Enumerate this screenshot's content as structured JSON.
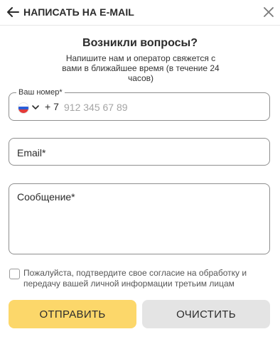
{
  "header": {
    "back_icon": "arrow-left-icon",
    "title": "НАПИСАТЬ НА E-MAIL",
    "close_icon": "close-icon"
  },
  "form": {
    "title": "Возникли вопросы?",
    "subtitle": "Напишите нам и оператор свяжется с вами в ближайшее время (в течение 24 часов)",
    "phone": {
      "label": "Ваш номер*",
      "country_flag": "flag-russia-icon",
      "dial_code": "+ 7",
      "placeholder": "912 345 67 89",
      "value": ""
    },
    "email": {
      "placeholder": "Email*",
      "value": ""
    },
    "message": {
      "placeholder": "Сообщение*",
      "value": ""
    },
    "consent": {
      "checked": false,
      "text": "Пожалуйста, подтвердите свое согласие на обработку и передачу вашей личной информации третьим лицам"
    },
    "buttons": {
      "send_label": "ОТПРАВИТЬ",
      "clear_label": "ОЧИСТИТЬ"
    }
  },
  "colors": {
    "accent": "#fcd76a",
    "secondary_button": "#e4e4e4",
    "border": "#8f8f8f",
    "text": "#2b2b2b"
  }
}
